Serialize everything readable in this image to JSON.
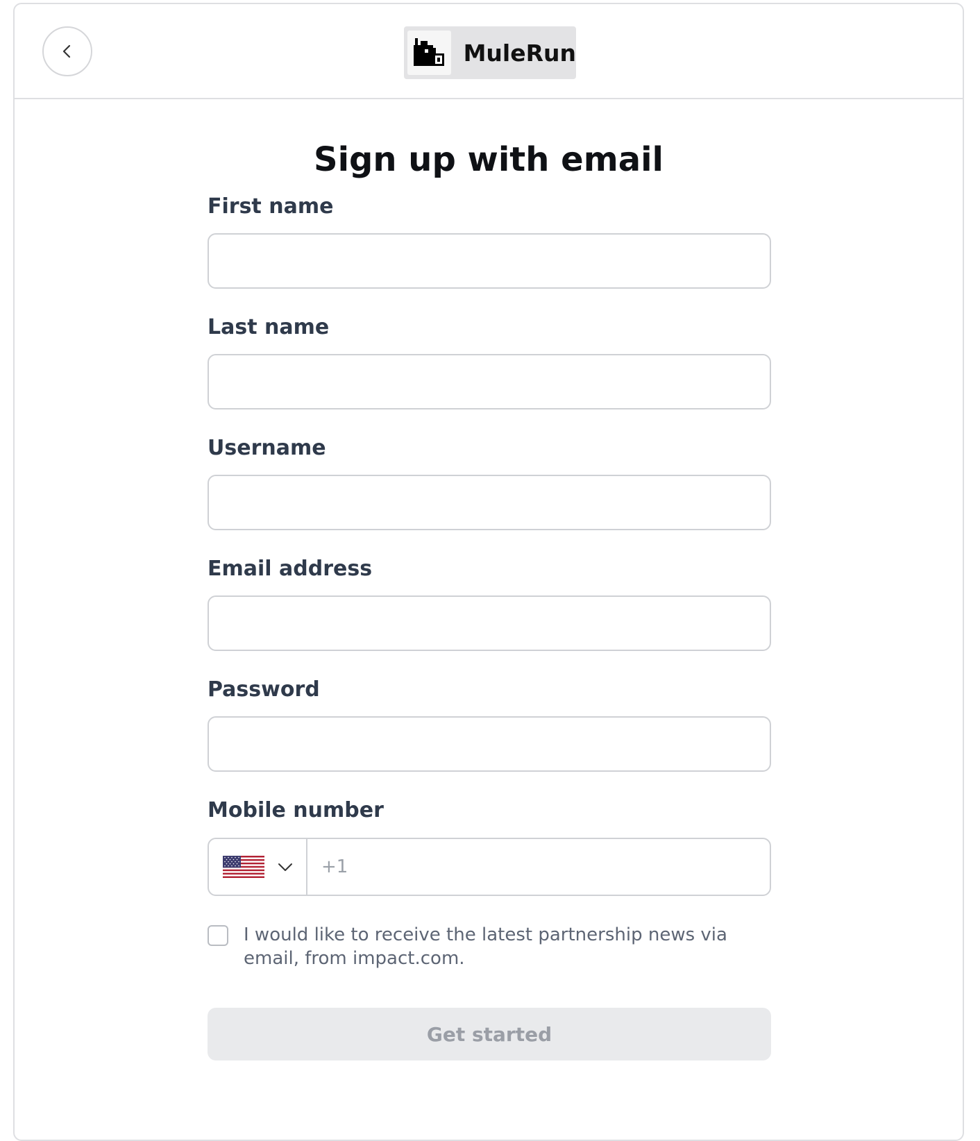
{
  "header": {
    "brand_name": "MuleRun",
    "back_icon": "chevron-left-icon",
    "logo_icon": "mule-logo-icon"
  },
  "form": {
    "title": "Sign up with email",
    "fields": {
      "first_name": {
        "label": "First name",
        "value": ""
      },
      "last_name": {
        "label": "Last name",
        "value": ""
      },
      "username": {
        "label": "Username",
        "value": ""
      },
      "email": {
        "label": "Email address",
        "value": ""
      },
      "password": {
        "label": "Password",
        "value": ""
      }
    },
    "mobile": {
      "label": "Mobile number",
      "country_icon": "us-flag-icon",
      "placeholder": "+1",
      "value": ""
    },
    "consent": {
      "text": "I would like to receive the latest partnership news via email, from impact.com.",
      "checked": false
    },
    "submit_label": "Get started"
  },
  "colors": {
    "label": "#2f3a4b",
    "border": "#cfd1d5",
    "button_bg": "#e9eaec",
    "button_text": "#9a9ea6"
  }
}
